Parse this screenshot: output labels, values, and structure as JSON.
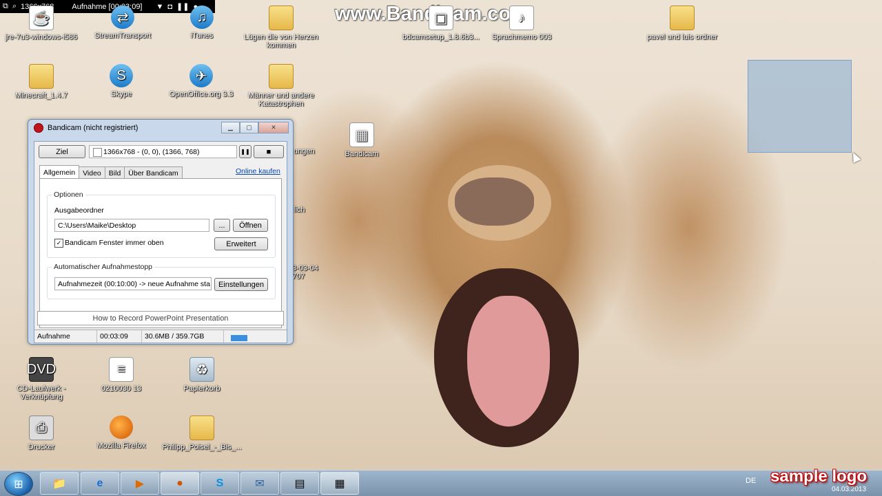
{
  "watermark": "www.Bandicam.com",
  "recording_bar": {
    "resolution": "1366x768",
    "status": "Aufnahme [00:03:09]"
  },
  "desktop_icons": [
    {
      "label": "jre-7u3-windows-i586",
      "icon": "installer-icon"
    },
    {
      "label": "StreamTransport",
      "icon": "app-shortcut-icon"
    },
    {
      "label": "iTunes",
      "icon": "itunes-icon"
    },
    {
      "label": "Lügen die von Herzen kommen",
      "icon": "folder-icon"
    },
    {
      "label": "bdcamsetup_1.8.6b3...",
      "icon": "installer-icon"
    },
    {
      "label": "Sprachmemo 003",
      "icon": "audio-file-icon"
    },
    {
      "label": "pavel und luis ordner",
      "icon": "folder-icon"
    },
    {
      "label": "Minecraft_1.4.7",
      "icon": "folder-icon"
    },
    {
      "label": "Skype",
      "icon": "skype-icon"
    },
    {
      "label": "OpenOffice.org 3.3",
      "icon": "openoffice-icon"
    },
    {
      "label": "Männer und andere Katastrophen",
      "icon": "folder-icon"
    },
    {
      "label": "Bandicam",
      "icon": "bandicam-icon"
    },
    {
      "label": "CD-Laufwerk - Verknüpfung",
      "icon": "dvd-drive-icon"
    },
    {
      "label": "0210030 13",
      "icon": "document-icon"
    },
    {
      "label": "Papierkorb",
      "icon": "recycle-bin-icon"
    },
    {
      "label": "Drucker",
      "icon": "printer-icon"
    },
    {
      "label": "Mozilla Firefox",
      "icon": "firefox-icon"
    },
    {
      "label": "Philipp_Poisel_-_Bis_...",
      "icon": "folder-icon"
    }
  ],
  "partial_labels": [
    "ungen",
    "lich",
    "3-03-04",
    "707"
  ],
  "bandicam": {
    "title": "Bandicam (nicht registriert)",
    "ziel_button": "Ziel",
    "target_field": "1366x768 - (0, 0), (1366, 768)",
    "pause_symbol": "❚❚",
    "stop_symbol": "■",
    "tabs": [
      "Allgemein",
      "Video",
      "Bild",
      "Über Bandicam"
    ],
    "online_link": "Online kaufen",
    "options_group": "Optionen",
    "output_label": "Ausgabeordner",
    "output_path": "C:\\Users\\Maike\\Desktop",
    "browse_button": "...",
    "open_button": "Öffnen",
    "always_on_top_label": "Bandicam Fenster immer oben",
    "always_on_top_checked": true,
    "advanced_button": "Erweitert",
    "autostop_group": "Automatischer Aufnahmestopp",
    "autostop_value": "Aufnahmezeit (00:10:00) -> neue Aufnahme sta",
    "settings_button": "Einstellungen",
    "howto_button": "How to Record PowerPoint Presentation",
    "status": {
      "state": "Aufnahme",
      "time": "00:03:09",
      "size": "30.6MB / 359.7GB"
    }
  },
  "taskbar": {
    "items": [
      "explorer-icon",
      "internet-explorer-icon",
      "media-player-icon",
      "firefox-icon",
      "skype-icon",
      "thunderbird-icon",
      "document-icon",
      "bandicam-icon"
    ],
    "language": "DE",
    "date": "04.03.2013"
  },
  "overlay_logo": "sample logo"
}
